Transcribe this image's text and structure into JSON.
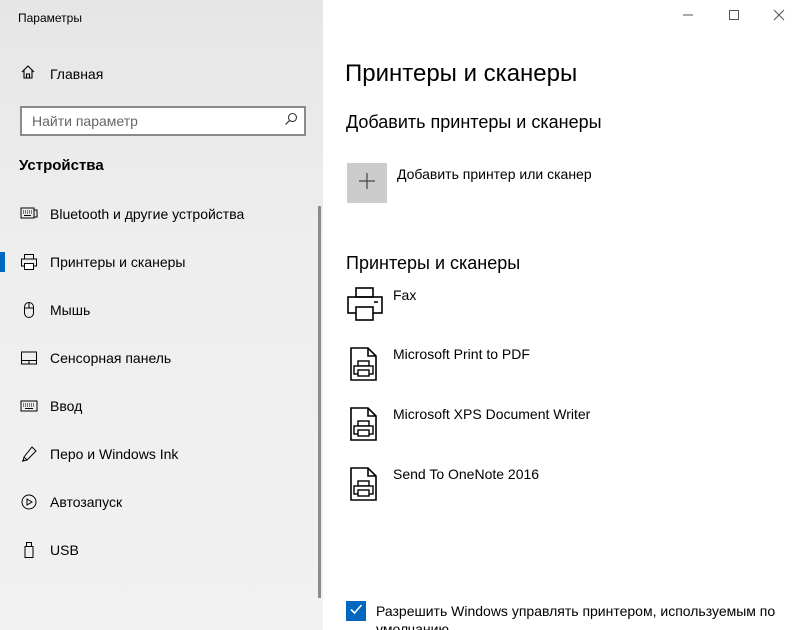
{
  "window": {
    "app_title": "Параметры",
    "controls": [
      "minimize-icon",
      "maximize-icon",
      "close-icon"
    ]
  },
  "sidebar": {
    "home_label": "Главная",
    "search_placeholder": "Найти параметр",
    "section_title": "Устройства",
    "items": [
      {
        "label": "Bluetooth и другие устройства",
        "icon": "bluetooth-devices-icon",
        "selected": false
      },
      {
        "label": "Принтеры и сканеры",
        "icon": "printer-icon",
        "selected": true
      },
      {
        "label": "Мышь",
        "icon": "mouse-icon",
        "selected": false
      },
      {
        "label": "Сенсорная панель",
        "icon": "touchpad-icon",
        "selected": false
      },
      {
        "label": "Ввод",
        "icon": "keyboard-icon",
        "selected": false
      },
      {
        "label": "Перо и Windows Ink",
        "icon": "pen-icon",
        "selected": false
      },
      {
        "label": "Автозапуск",
        "icon": "autoplay-icon",
        "selected": false
      },
      {
        "label": "USB",
        "icon": "usb-icon",
        "selected": false
      }
    ]
  },
  "main": {
    "page_title": "Принтеры и сканеры",
    "add_section_title": "Добавить принтеры и сканеры",
    "add_label": "Добавить принтер или сканер",
    "list_title": "Принтеры и сканеры",
    "printers": [
      {
        "name": "Fax",
        "icon": "fax-printer-icon"
      },
      {
        "name": "Microsoft Print to PDF",
        "icon": "document-printer-icon"
      },
      {
        "name": "Microsoft XPS Document Writer",
        "icon": "document-printer-icon"
      },
      {
        "name": "Send To OneNote 2016",
        "icon": "document-printer-icon"
      }
    ],
    "default_checkbox": {
      "checked": true,
      "label": "Разрешить Windows управлять принтером, используемым по умолчанию"
    }
  },
  "colors": {
    "accent": "#0067c0",
    "sidebar_bg": "#eeeeee",
    "add_button_bg": "#cccccc"
  }
}
